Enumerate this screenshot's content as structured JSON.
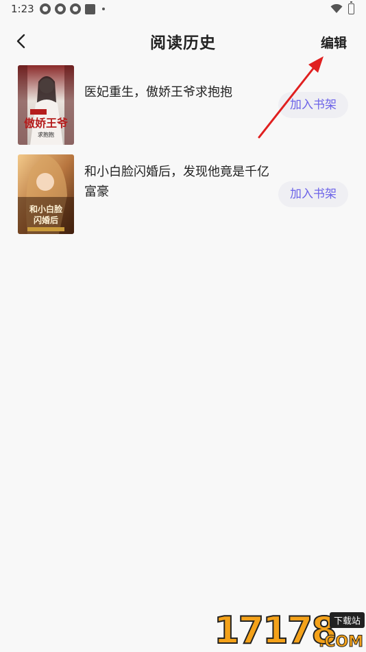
{
  "status_bar": {
    "time": "1:23"
  },
  "header": {
    "title": "阅读历史",
    "edit_label": "编辑",
    "back_icon": "chevron-left-icon"
  },
  "history": [
    {
      "title": "医妃重生，傲娇王爷求抱抱",
      "add_label": "加入书架",
      "cover_text": "傲娇王爷"
    },
    {
      "title": "和小白脸闪婚后，发现他竟是千亿富豪",
      "add_label": "加入书架",
      "cover_text": "和小白脸闪婚后"
    }
  ],
  "watermark": {
    "digits": "17178",
    "tag": "下载站",
    "suffix": ".COM"
  },
  "colors": {
    "accent": "#6c63e8",
    "button_bg": "#efeff3",
    "annotation": "#e02020"
  }
}
